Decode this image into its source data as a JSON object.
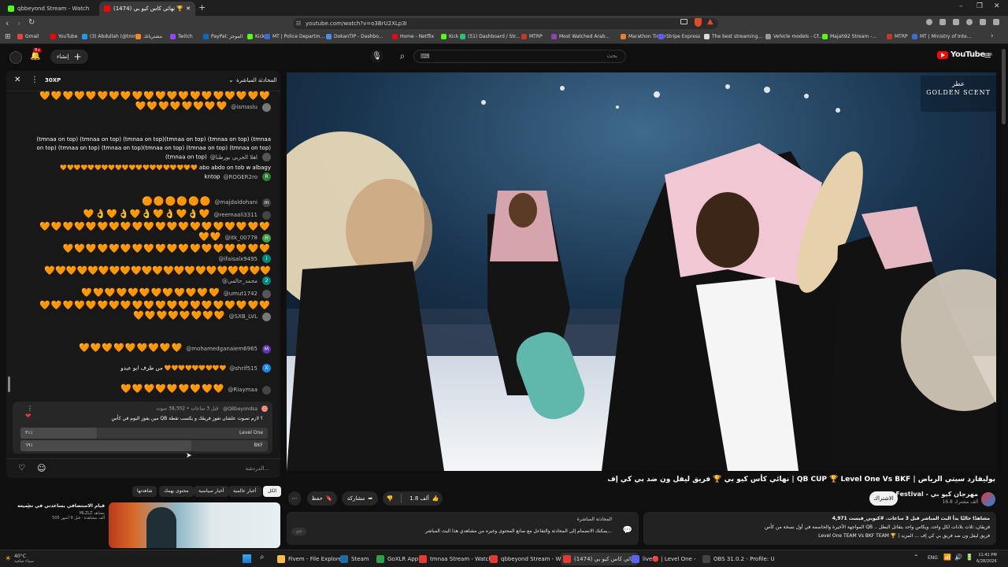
{
  "browser": {
    "tabs": [
      {
        "label": "qbbeyond Stream - Watch Live on Ki"
      },
      {
        "label": "(1474) نهائي كأس كيو بي 🏆"
      }
    ],
    "new_tab": "+",
    "url": "youtube.com/watch?v=o3BrU2XLp3I",
    "window_controls": {
      "min": "–",
      "max": "❐",
      "close": "✕"
    }
  },
  "bookmarks": [
    {
      "label": "Gmail",
      "color": "#ea4335"
    },
    {
      "label": "YouTube",
      "color": "#ff0000"
    },
    {
      "label": "(3) Abdullah (@tmn...",
      "color": "#1d9bf0"
    },
    {
      "label": "مشترياتك",
      "color": "#f08a24"
    },
    {
      "label": "Twitch",
      "color": "#9146ff"
    },
    {
      "label": "PayPal: الموجز",
      "color": "#0070ba"
    },
    {
      "label": "Kick",
      "color": "#53fc18"
    },
    {
      "label": "MT | Police Departm...",
      "color": "#3d6bd6"
    },
    {
      "label": "DokanTIP - Dashbo...",
      "color": "#4a90e2"
    },
    {
      "label": "Home - Netflix",
      "color": "#e50914"
    },
    {
      "label": "Kick",
      "color": "#53fc18"
    },
    {
      "label": "(51) Dashboard / Str...",
      "color": "#2fbf71"
    },
    {
      "label": "MTRP",
      "color": "#c0392b"
    },
    {
      "label": "Most Watched Arab...",
      "color": "#8e44ad"
    },
    {
      "label": "Marathon Timer",
      "color": "#e67e22"
    },
    {
      "label": "Stripe Express",
      "color": "#635bff"
    },
    {
      "label": "The best streaming...",
      "color": "#dddddd"
    },
    {
      "label": "Vehicle models - Cf...",
      "color": "#999999"
    },
    {
      "label": "Majah92 Stream -...",
      "color": "#53fc18"
    },
    {
      "label": "MTRP",
      "color": "#c0392b"
    },
    {
      "label": "MT | Ministry of Inte...",
      "color": "#3d6bd6"
    }
  ],
  "yt_header": {
    "create_label": "إنشاء",
    "search_placeholder": "بحث",
    "logo": "YouTube",
    "logo_region": "SA",
    "notif_count": "9+"
  },
  "chat": {
    "title": "المحادثة المباشرة",
    "xp": "30XP",
    "messages": [
      {
        "user": "@ismaslu",
        "text": "🧡🧡🧡🧡🧡🧡🧡🧡🧡🧡🧡🧡🧡🧡🧡🧡🧡🧡🧡🧡🧡🧡🧡🧡🧡🧡🧡🧡",
        "avatar_color": "#777"
      },
      {
        "user": "@اهلا الحربي بورطنا",
        "text": "(tmnaa on top) (tmnaa on top) (tmnaa on top)(tmnaa on top) (tmnaa on top) (tmnaa on top) (tmnaa on top) (tmnaa on top)(tmnaa on top) (tmnaa on top) (tmnaa on top) (tmnaa on top)",
        "avatar_color": "#555"
      },
      {
        "user": "@ROGER2ro",
        "text": "🧡🧡🧡🧡🧡🧡🧡🧡🧡🧡🧡🧡🧡🧡🧡🧡🧡🧡🧡🧡 abo abdo on tob w albagy kntop",
        "avatar_color": "#2e7d32",
        "initial": "R"
      },
      {
        "user": "@majdaldohani",
        "text": "🟠🟠🟠🟠🟠🟠",
        "avatar_color": "#444",
        "initial": "m"
      },
      {
        "user": "@reemaali3311",
        "text": "🧡👌🧡👌🧡👌🧡👌🧡👌🧡",
        "avatar_color": "#444"
      },
      {
        "user": "@itk_00778",
        "text": "🧡🧡🧡🧡🧡🧡🧡🧡🧡🧡🧡🧡🧡🧡🧡🧡🧡🧡🧡🧡🧡🧡",
        "avatar_color": "#43a047",
        "initial": "H"
      },
      {
        "user": "@ifaisalx9495",
        "text": "🧡🧡🧡🧡🧡🧡🧡🧡🧡🧡🧡🧡🧡🧡🧡🧡🧡🧡",
        "avatar_color": "#00897b",
        "initial": "i"
      },
      {
        "user": "@محمد_حالمي",
        "text": "🧡🧡🧡🧡🧡🧡🧡🧡🧡🧡🧡🧡🧡🧡🧡🧡🧡🧡🧡🧡🧡",
        "avatar_color": "#00897b",
        "initial": "2"
      },
      {
        "user": "@umut1742",
        "text": "🧡🧡🧡🧡🧡🧡🧡🧡🧡🧡🧡🧡",
        "avatar_color": "#555"
      },
      {
        "user": "@SXB_LVL",
        "text": "🧡🧡🧡🧡🧡🧡🧡🧡🧡🧡🧡🧡🧡🧡🧡🧡🧡🧡🧡🧡🧡🧡🧡🧡🧡🧡🧡🧡",
        "avatar_color": "#777"
      },
      {
        "user": "@mohamedganaiem6965",
        "text": "🧡🧡🧡🧡🧡🧡🧡🧡🧡",
        "avatar_color": "#5e35b1",
        "initial": "M"
      },
      {
        "user": "@shrif515",
        "text": "من طرف ابو عبدو 🧡🧡🧡🧡🧡🧡🧡🧡🧡",
        "avatar_color": "#1e88e5",
        "initial": "X"
      },
      {
        "user": "@Riaymaa",
        "text": "🧡🧡🧡🧡🧡🧡🧡🧡🧡",
        "avatar_color": "#444"
      }
    ],
    "poll": {
      "author": "@QBbeyondsa",
      "meta": "قبل 3 ساعات • 38,302 صوت",
      "question": "مين يفوز اليوم في كأس QB ؟ لازم تصوت علشان تفوز فريقك و يكسب نقطة",
      "options": [
        {
          "label": "Level One",
          "pct": "٣١٪",
          "value": 31
        },
        {
          "label": "BKF",
          "pct": "٦٩٪",
          "value": 69
        }
      ]
    },
    "input_placeholder": "الدردشة..."
  },
  "video": {
    "badge": "GOLDEN SCENT",
    "badge_ar": "عطر"
  },
  "video_info": {
    "title": "نهائي كأس كيو بي 🏆 فريق ليفل ون ضد بي كي إف | QB CUP 🏆 Level One Vs BKF | بوليفارد سيتي الرياض",
    "channel": "QB Festival - مهرجان كيو بي",
    "subs": "16.8 ألف مشترك",
    "subscribe": "الاشتراك",
    "likes": "1.8 ألف",
    "share": "مشاركة",
    "save": "حفظ",
    "more": "⋯"
  },
  "description": {
    "stats": "4,971 مشاهدًا حاليًا بدأ البث المباشر قبل 3 ساعات. #كيوبي_فيست",
    "line2": "المواجهة الأخيرة والحاسمة في أول نسخة من كأس QB .. فريقان، ثلاث بلادات لكل واحد، ويكاس واحد يتقاتل البطل",
    "line3": "Level One TEAM Vs BKF TEAM 🏆 | فريق ليفل ون ضد فريق بي كي إف ... المزيد"
  },
  "livechat_card": {
    "title": "المحادثة المباشرة",
    "text": "يمكنك الانضمام إلى المحادثة والتفاعل مع صانع المحتوى وغيره من مشاهدي هذا البث المباشر...",
    "button": "فتح"
  },
  "chips": [
    {
      "label": "الكل"
    },
    {
      "label": "أخبار عالمية"
    },
    {
      "label": "أخبار سياسية"
    },
    {
      "label": "محتوى يهمك"
    },
    {
      "label": "شاهدتها"
    }
  ],
  "suggestion": {
    "title": "قيام الاستضافي يساعدني في تجميعة",
    "channel": "MLZLZ مشاهد",
    "views": "505 ألف مشاهدة · قبل 9 أشهر"
  },
  "taskbar": {
    "weather_temp": "40°C",
    "weather_desc": "سماء صافية",
    "apps": [
      {
        "label": "Fivem - File Explorer",
        "color": "#f3c14b"
      },
      {
        "label": "Steam",
        "color": "#1b6fa8"
      },
      {
        "label": "GoXLR App",
        "color": "#2ea043"
      },
      {
        "label": "tmnaa Stream - Watch L",
        "color": "#e53935"
      },
      {
        "label": "qbbeyond Stream - Wat",
        "color": "#e53935"
      },
      {
        "label": "(1474) نهائي كأس كيو بي",
        "color": "#e53935"
      },
      {
        "label": "live🔴 | Level One -",
        "color": "#5865f2"
      },
      {
        "label": "OBS 31.0.2 - Profile: Unt",
        "color": "#444"
      }
    ],
    "lang": "ENG",
    "time": "11:41 PM",
    "date": "6/28/2026"
  }
}
